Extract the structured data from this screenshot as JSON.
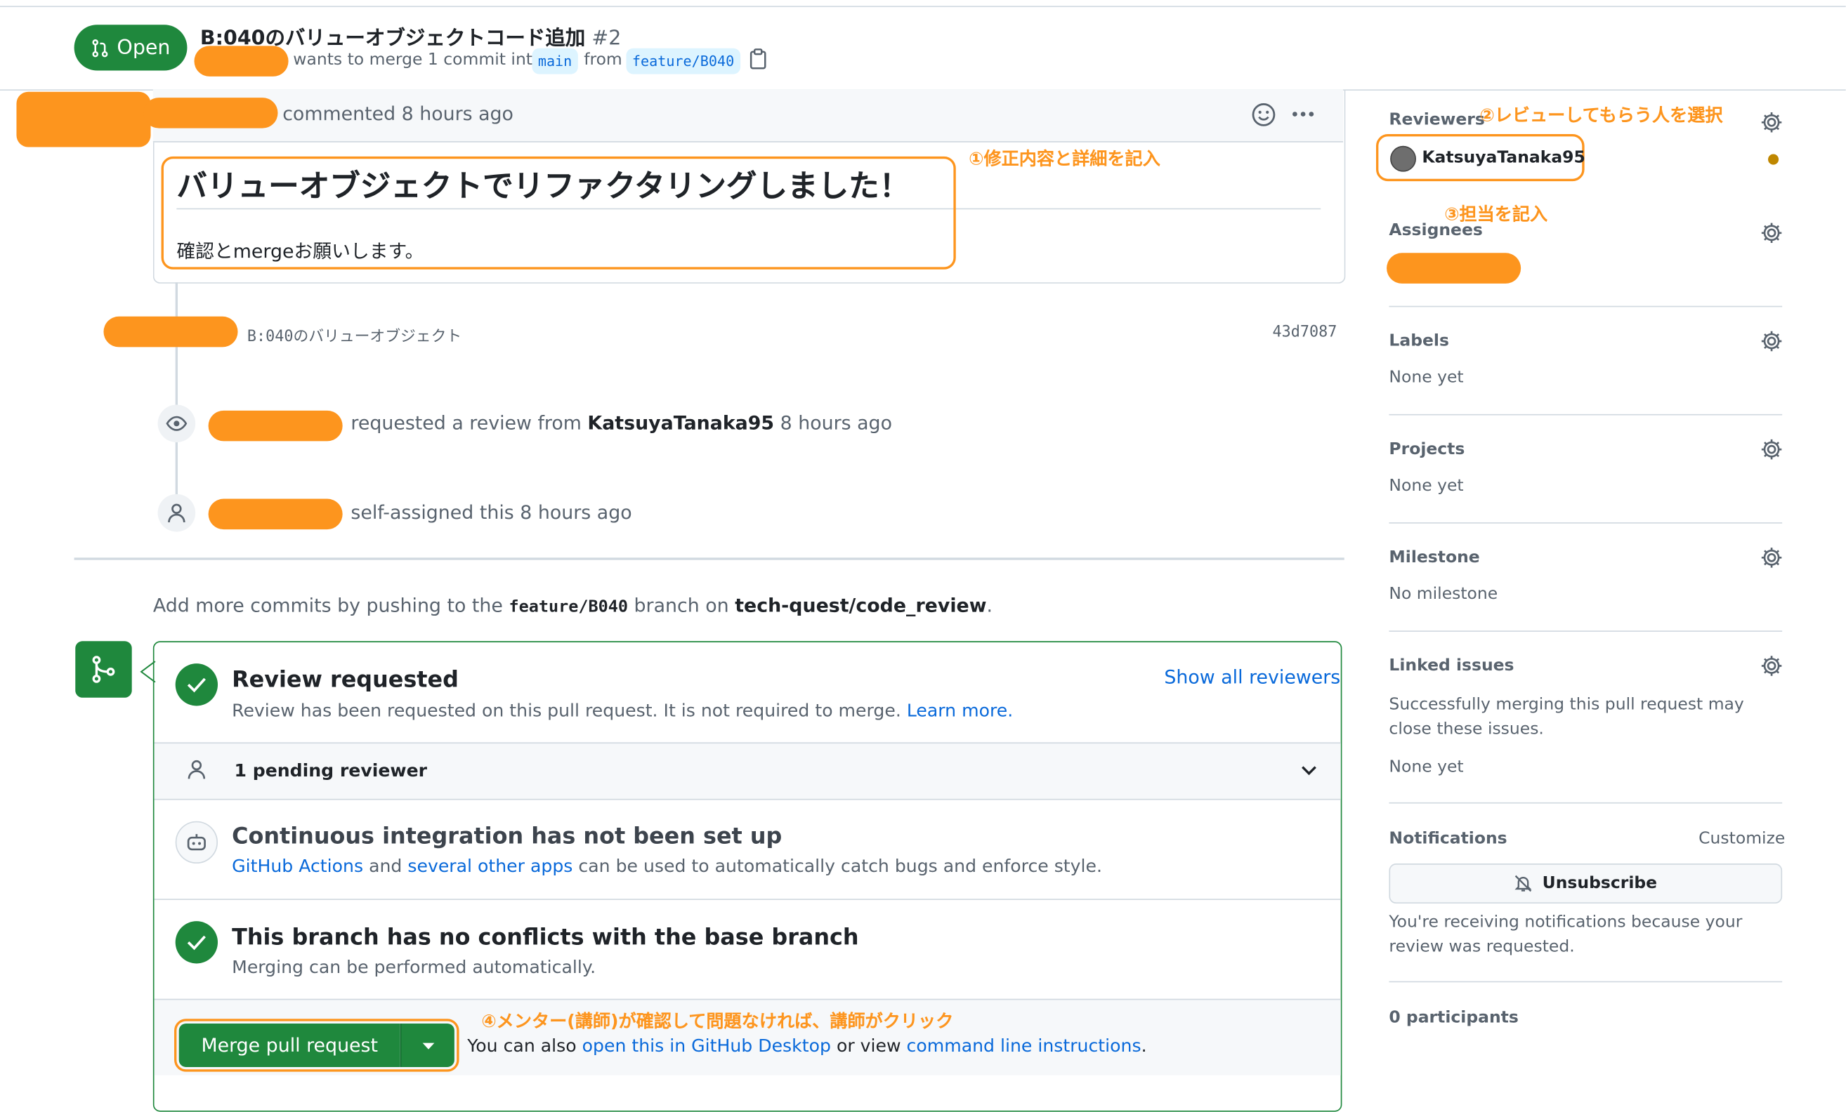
{
  "header": {
    "state_badge": "Open",
    "title": "B:040のバリューオブジェクトコード追加",
    "number": "#2",
    "merge_text": "wants to merge 1 commit into",
    "base_branch": "main",
    "from_text": "from",
    "head_branch": "feature/B040"
  },
  "comment": {
    "action": "commented 8 hours ago",
    "heading": "バリューオブジェクトでリファクタリングしました！",
    "body": "確認とmergeお願いします。"
  },
  "timeline": {
    "commit_message": "B:040のバリューオブジェクト",
    "commit_sha": "43d7087",
    "review_request_prefix": "requested a review from",
    "review_request_user": "KatsuyaTanaka95",
    "review_request_time": "8 hours ago",
    "self_assigned": "self-assigned this 8 hours ago"
  },
  "add_commits": {
    "prefix": "Add more commits by pushing to the",
    "branch": "feature/B040",
    "middle": "branch on",
    "repo": "tech-quest/code_review",
    "suffix": "."
  },
  "merge_box": {
    "review_title": "Review requested",
    "review_desc": "Review has been requested on this pull request. It is not required to merge.",
    "learn_more": "Learn more.",
    "show_all": "Show all reviewers",
    "pending": "1 pending reviewer",
    "ci_title": "Continuous integration has not been set up",
    "ci_link1": "GitHub Actions",
    "ci_and": "and",
    "ci_link2": "several other apps",
    "ci_rest": "can be used to automatically catch bugs and enforce style.",
    "conflict_title": "This branch has no conflicts with the base branch",
    "conflict_desc": "Merging can be performed automatically.",
    "merge_button": "Merge pull request",
    "also_prefix": "You can also",
    "also_link1": "open this in GitHub Desktop",
    "also_mid": "or view",
    "also_link2": "command line instructions",
    "also_suffix": "."
  },
  "sidebar": {
    "reviewers_label": "Reviewers",
    "reviewer_name": "KatsuyaTanaka95",
    "assignees_label": "Assignees",
    "labels_label": "Labels",
    "labels_value": "None yet",
    "projects_label": "Projects",
    "projects_value": "None yet",
    "milestone_label": "Milestone",
    "milestone_value": "No milestone",
    "linked_label": "Linked issues",
    "linked_desc": "Successfully merging this pull request may close these issues.",
    "linked_value": "None yet",
    "notifications_label": "Notifications",
    "customize": "Customize",
    "unsubscribe": "Unsubscribe",
    "notif_reason": "You're receiving notifications because your review was requested.",
    "participants": "0 participants"
  },
  "annotations": {
    "a1": "①修正内容と詳細を記入",
    "a2": "②レビューしてもらう人を選択",
    "a3": "③担当を記入",
    "a4": "④メンター(講師)が確認して問題なければ、講師がクリック"
  },
  "colors": {
    "accent_green": "#1f883d",
    "link_blue": "#0969da",
    "annotation_orange": "#fd951e",
    "border": "#d1d9e0"
  }
}
